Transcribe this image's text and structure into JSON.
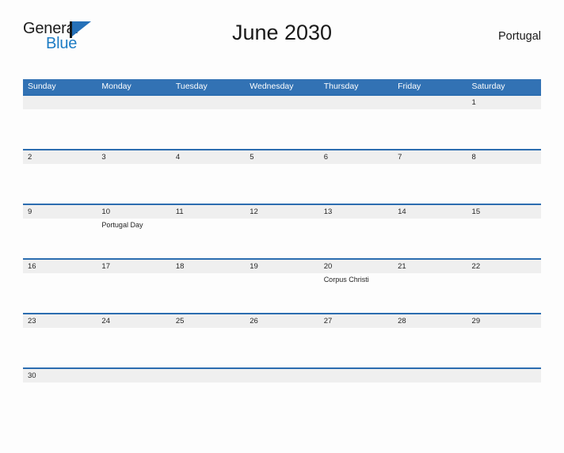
{
  "brand": {
    "word_one": "General",
    "word_two": "Blue",
    "accent_color": "#1d7cc4",
    "triangle_color": "#2570b8",
    "logo_icon": "general-blue-sail-logo"
  },
  "header": {
    "title": "June 2030",
    "country": "Portugal"
  },
  "calendar": {
    "header_background": "#3272b4",
    "row_divider_color": "#2c6db0",
    "daynum_band_color": "#efefef",
    "weekdays": [
      "Sunday",
      "Monday",
      "Tuesday",
      "Wednesday",
      "Thursday",
      "Friday",
      "Saturday"
    ],
    "weeks": [
      {
        "daynums": [
          "",
          "",
          "",
          "",
          "",
          "",
          "1"
        ],
        "events": [
          "",
          "",
          "",
          "",
          "",
          "",
          ""
        ]
      },
      {
        "daynums": [
          "2",
          "3",
          "4",
          "5",
          "6",
          "7",
          "8"
        ],
        "events": [
          "",
          "",
          "",
          "",
          "",
          "",
          ""
        ]
      },
      {
        "daynums": [
          "9",
          "10",
          "11",
          "12",
          "13",
          "14",
          "15"
        ],
        "events": [
          "",
          "Portugal Day",
          "",
          "",
          "",
          "",
          ""
        ]
      },
      {
        "daynums": [
          "16",
          "17",
          "18",
          "19",
          "20",
          "21",
          "22"
        ],
        "events": [
          "",
          "",
          "",
          "",
          "Corpus Christi",
          "",
          ""
        ]
      },
      {
        "daynums": [
          "23",
          "24",
          "25",
          "26",
          "27",
          "28",
          "29"
        ],
        "events": [
          "",
          "",
          "",
          "",
          "",
          "",
          ""
        ]
      },
      {
        "daynums": [
          "30",
          "",
          "",
          "",
          "",
          "",
          ""
        ],
        "events": [
          "",
          "",
          "",
          "",
          "",
          "",
          ""
        ]
      }
    ]
  }
}
